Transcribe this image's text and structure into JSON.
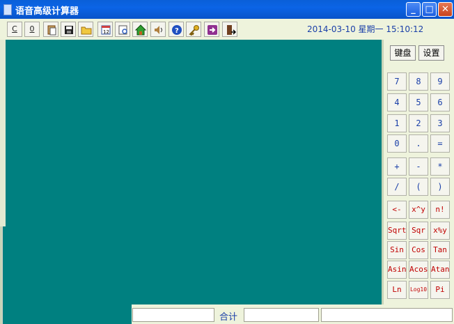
{
  "window": {
    "title": "语音高级计算器",
    "min_label": "_",
    "max_label": "□",
    "close_label": "✕"
  },
  "toolbar": {
    "buttons": [
      {
        "name": "clear-button",
        "label": "C",
        "icon": "clear"
      },
      {
        "name": "zero-button",
        "label": "0",
        "icon": "zero"
      },
      {
        "name": "paste-button",
        "label": "",
        "icon": "paste-icon"
      },
      {
        "name": "save-button",
        "label": "",
        "icon": "save-icon"
      },
      {
        "name": "open-button",
        "label": "",
        "icon": "folder-icon"
      },
      {
        "name": "calendar-button",
        "label": "",
        "icon": "calendar-icon"
      },
      {
        "name": "preview-button",
        "label": "",
        "icon": "preview-icon"
      },
      {
        "name": "home-button",
        "label": "",
        "icon": "home-icon"
      },
      {
        "name": "speaker-button",
        "label": "",
        "icon": "speaker-icon"
      },
      {
        "name": "help-button",
        "label": "",
        "icon": "help-icon"
      },
      {
        "name": "key-button",
        "label": "",
        "icon": "key-icon"
      },
      {
        "name": "forward-button",
        "label": "",
        "icon": "arrow-right-icon"
      },
      {
        "name": "exit-button",
        "label": "",
        "icon": "exit-icon"
      }
    ],
    "datetime": "2014-03-10  星期一  15:10:12"
  },
  "tabs": {
    "keyboard": "键盘",
    "settings": "设置"
  },
  "keys": {
    "row1": [
      "7",
      "8",
      "9"
    ],
    "row2": [
      "4",
      "5",
      "6"
    ],
    "row3": [
      "1",
      "2",
      "3"
    ],
    "row4": [
      "0",
      ".",
      "="
    ],
    "row5": [
      "+",
      "-",
      "*"
    ],
    "row6": [
      "/",
      "(",
      ")"
    ],
    "row7": [
      "<-",
      "x^y",
      "n!"
    ],
    "row8": [
      "Sqrt",
      "Sqr",
      "x%y"
    ],
    "row9": [
      "Sin",
      "Cos",
      "Tan"
    ],
    "row10": [
      "Asin",
      "Acos",
      "Atan"
    ],
    "row11": [
      "Ln",
      "Log10",
      "Pi"
    ]
  },
  "statusbar": {
    "total_label": "合计",
    "field1": "",
    "field2": "",
    "field3": ""
  },
  "colors": {
    "titlebar": "#0b64e6",
    "display": "#008080",
    "panel": "#eef3dc",
    "blue_text": "#1a3fa8",
    "red_text": "#c00000"
  }
}
